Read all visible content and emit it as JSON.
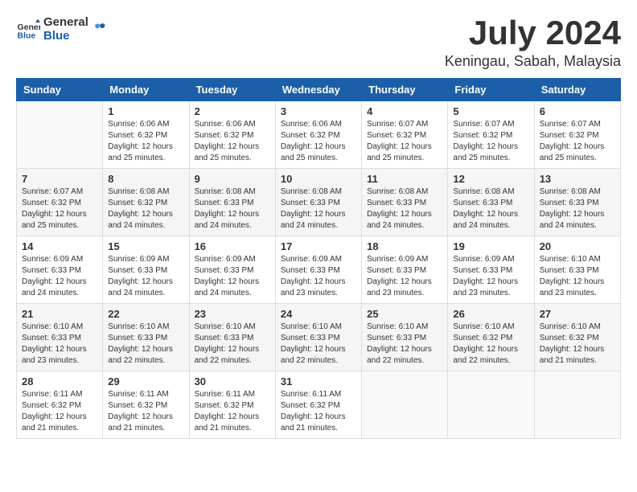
{
  "header": {
    "logo_general": "General",
    "logo_blue": "Blue",
    "month_title": "July 2024",
    "location": "Keningau, Sabah, Malaysia"
  },
  "weekdays": [
    "Sunday",
    "Monday",
    "Tuesday",
    "Wednesday",
    "Thursday",
    "Friday",
    "Saturday"
  ],
  "weeks": [
    [
      {
        "day": "",
        "info": ""
      },
      {
        "day": "1",
        "info": "Sunrise: 6:06 AM\nSunset: 6:32 PM\nDaylight: 12 hours\nand 25 minutes."
      },
      {
        "day": "2",
        "info": "Sunrise: 6:06 AM\nSunset: 6:32 PM\nDaylight: 12 hours\nand 25 minutes."
      },
      {
        "day": "3",
        "info": "Sunrise: 6:06 AM\nSunset: 6:32 PM\nDaylight: 12 hours\nand 25 minutes."
      },
      {
        "day": "4",
        "info": "Sunrise: 6:07 AM\nSunset: 6:32 PM\nDaylight: 12 hours\nand 25 minutes."
      },
      {
        "day": "5",
        "info": "Sunrise: 6:07 AM\nSunset: 6:32 PM\nDaylight: 12 hours\nand 25 minutes."
      },
      {
        "day": "6",
        "info": "Sunrise: 6:07 AM\nSunset: 6:32 PM\nDaylight: 12 hours\nand 25 minutes."
      }
    ],
    [
      {
        "day": "7",
        "info": "Sunrise: 6:07 AM\nSunset: 6:32 PM\nDaylight: 12 hours\nand 25 minutes."
      },
      {
        "day": "8",
        "info": "Sunrise: 6:08 AM\nSunset: 6:32 PM\nDaylight: 12 hours\nand 24 minutes."
      },
      {
        "day": "9",
        "info": "Sunrise: 6:08 AM\nSunset: 6:33 PM\nDaylight: 12 hours\nand 24 minutes."
      },
      {
        "day": "10",
        "info": "Sunrise: 6:08 AM\nSunset: 6:33 PM\nDaylight: 12 hours\nand 24 minutes."
      },
      {
        "day": "11",
        "info": "Sunrise: 6:08 AM\nSunset: 6:33 PM\nDaylight: 12 hours\nand 24 minutes."
      },
      {
        "day": "12",
        "info": "Sunrise: 6:08 AM\nSunset: 6:33 PM\nDaylight: 12 hours\nand 24 minutes."
      },
      {
        "day": "13",
        "info": "Sunrise: 6:08 AM\nSunset: 6:33 PM\nDaylight: 12 hours\nand 24 minutes."
      }
    ],
    [
      {
        "day": "14",
        "info": "Sunrise: 6:09 AM\nSunset: 6:33 PM\nDaylight: 12 hours\nand 24 minutes."
      },
      {
        "day": "15",
        "info": "Sunrise: 6:09 AM\nSunset: 6:33 PM\nDaylight: 12 hours\nand 24 minutes."
      },
      {
        "day": "16",
        "info": "Sunrise: 6:09 AM\nSunset: 6:33 PM\nDaylight: 12 hours\nand 24 minutes."
      },
      {
        "day": "17",
        "info": "Sunrise: 6:09 AM\nSunset: 6:33 PM\nDaylight: 12 hours\nand 23 minutes."
      },
      {
        "day": "18",
        "info": "Sunrise: 6:09 AM\nSunset: 6:33 PM\nDaylight: 12 hours\nand 23 minutes."
      },
      {
        "day": "19",
        "info": "Sunrise: 6:09 AM\nSunset: 6:33 PM\nDaylight: 12 hours\nand 23 minutes."
      },
      {
        "day": "20",
        "info": "Sunrise: 6:10 AM\nSunset: 6:33 PM\nDaylight: 12 hours\nand 23 minutes."
      }
    ],
    [
      {
        "day": "21",
        "info": "Sunrise: 6:10 AM\nSunset: 6:33 PM\nDaylight: 12 hours\nand 23 minutes."
      },
      {
        "day": "22",
        "info": "Sunrise: 6:10 AM\nSunset: 6:33 PM\nDaylight: 12 hours\nand 22 minutes."
      },
      {
        "day": "23",
        "info": "Sunrise: 6:10 AM\nSunset: 6:33 PM\nDaylight: 12 hours\nand 22 minutes."
      },
      {
        "day": "24",
        "info": "Sunrise: 6:10 AM\nSunset: 6:33 PM\nDaylight: 12 hours\nand 22 minutes."
      },
      {
        "day": "25",
        "info": "Sunrise: 6:10 AM\nSunset: 6:33 PM\nDaylight: 12 hours\nand 22 minutes."
      },
      {
        "day": "26",
        "info": "Sunrise: 6:10 AM\nSunset: 6:32 PM\nDaylight: 12 hours\nand 22 minutes."
      },
      {
        "day": "27",
        "info": "Sunrise: 6:10 AM\nSunset: 6:32 PM\nDaylight: 12 hours\nand 21 minutes."
      }
    ],
    [
      {
        "day": "28",
        "info": "Sunrise: 6:11 AM\nSunset: 6:32 PM\nDaylight: 12 hours\nand 21 minutes."
      },
      {
        "day": "29",
        "info": "Sunrise: 6:11 AM\nSunset: 6:32 PM\nDaylight: 12 hours\nand 21 minutes."
      },
      {
        "day": "30",
        "info": "Sunrise: 6:11 AM\nSunset: 6:32 PM\nDaylight: 12 hours\nand 21 minutes."
      },
      {
        "day": "31",
        "info": "Sunrise: 6:11 AM\nSunset: 6:32 PM\nDaylight: 12 hours\nand 21 minutes."
      },
      {
        "day": "",
        "info": ""
      },
      {
        "day": "",
        "info": ""
      },
      {
        "day": "",
        "info": ""
      }
    ]
  ]
}
